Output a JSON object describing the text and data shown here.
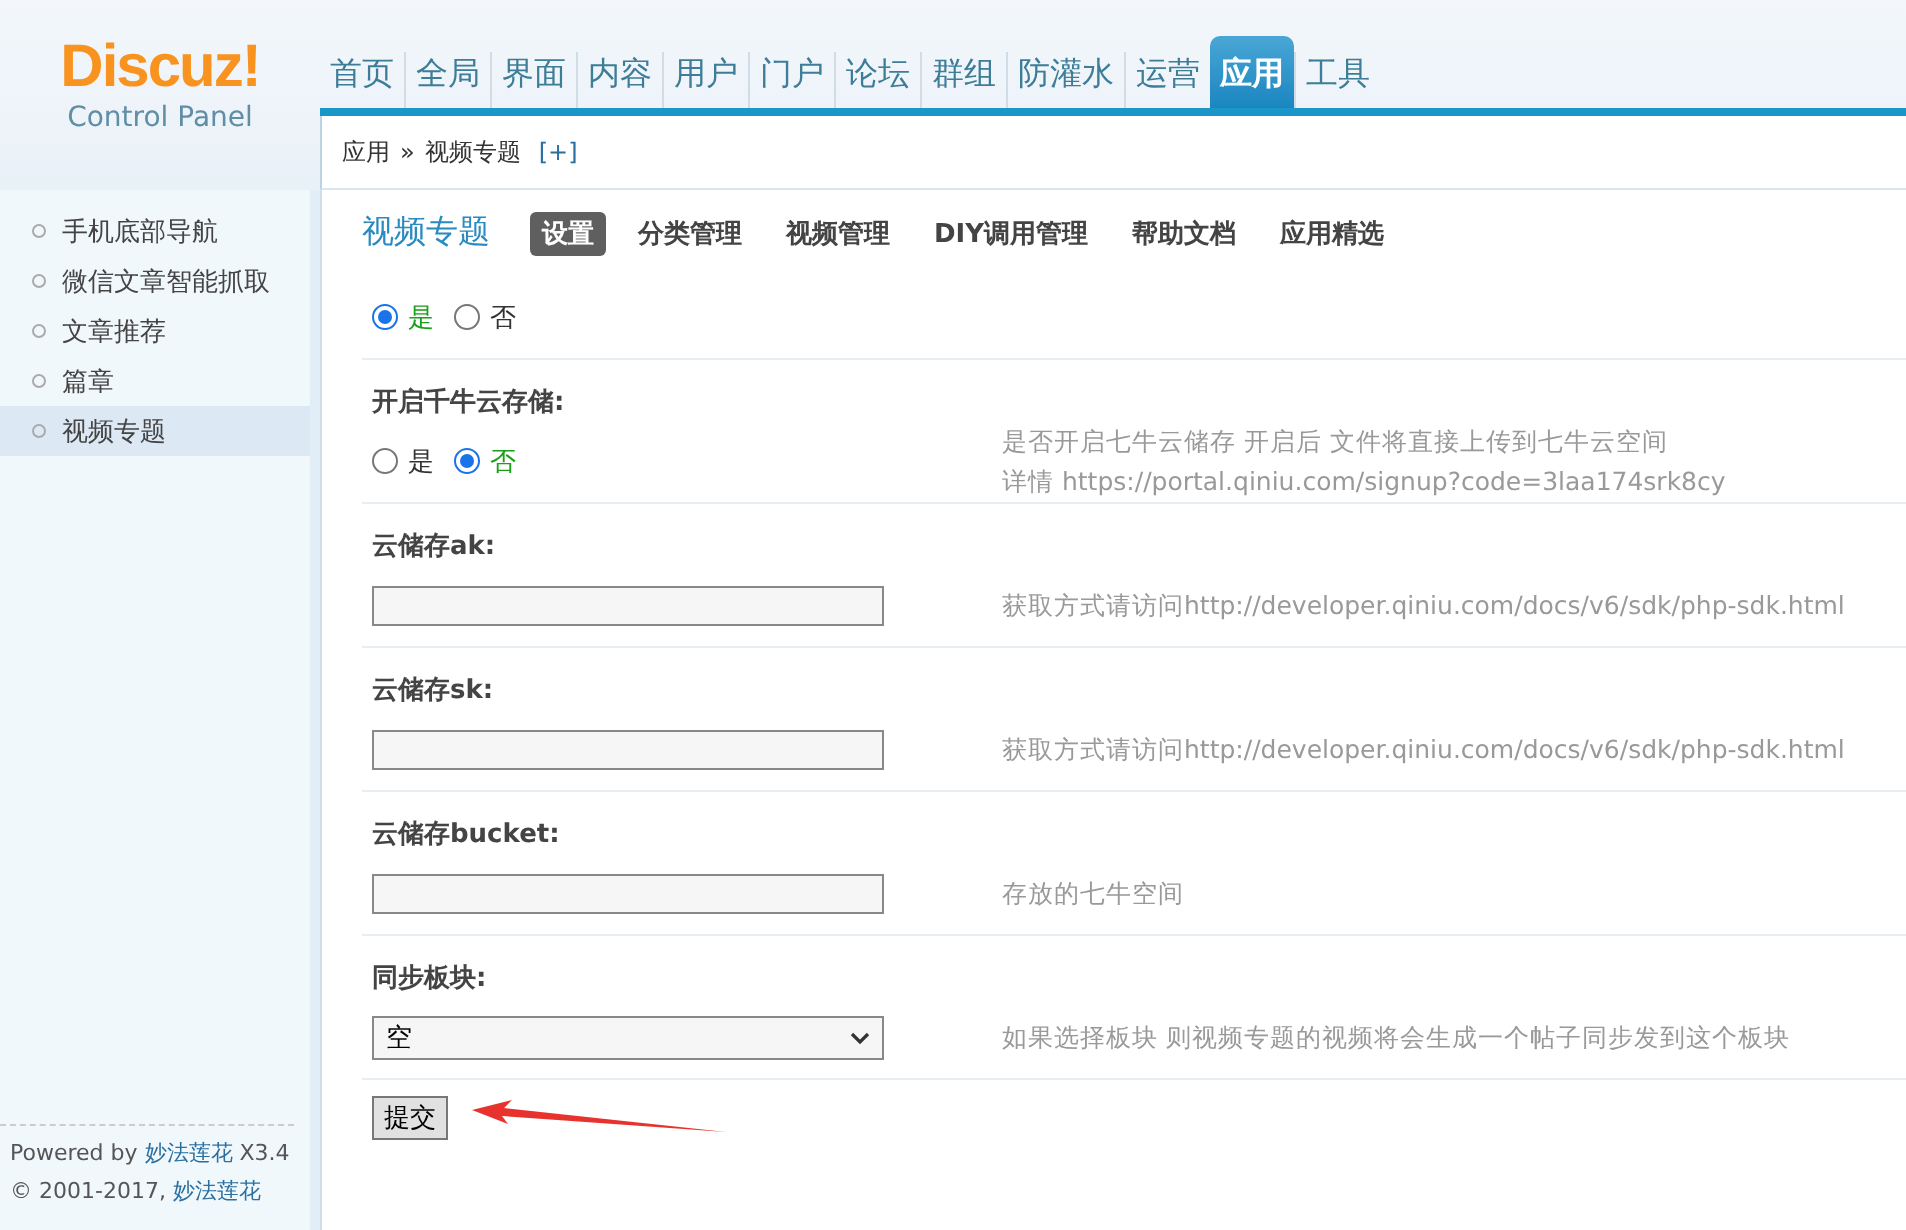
{
  "logo": {
    "brand": "Discuz!",
    "subtitle": "Control Panel"
  },
  "nav": [
    {
      "label": "首页",
      "selected": false
    },
    {
      "label": "全局",
      "selected": false
    },
    {
      "label": "界面",
      "selected": false
    },
    {
      "label": "内容",
      "selected": false
    },
    {
      "label": "用户",
      "selected": false
    },
    {
      "label": "门户",
      "selected": false
    },
    {
      "label": "论坛",
      "selected": false
    },
    {
      "label": "群组",
      "selected": false
    },
    {
      "label": "防灌水",
      "selected": false
    },
    {
      "label": "运营",
      "selected": false
    },
    {
      "label": "应用",
      "selected": true
    },
    {
      "label": "工具",
      "selected": false
    }
  ],
  "breadcrumb": {
    "parent": "应用",
    "separator": "»",
    "current": "视频专题",
    "add": "[+]"
  },
  "sidebar": {
    "items": [
      {
        "label": "手机底部导航",
        "selected": false
      },
      {
        "label": "微信文章智能抓取",
        "selected": false
      },
      {
        "label": "文章推荐",
        "selected": false
      },
      {
        "label": "篇章",
        "selected": false
      },
      {
        "label": "视频专题",
        "selected": true
      }
    ],
    "footer": {
      "powered": "Powered by",
      "powered_link": "妙法莲花",
      "version": "X3.4",
      "copyright": "© 2001-2017,",
      "copyright_link": "妙法莲花"
    }
  },
  "page": {
    "title": "视频专题",
    "tabs": [
      {
        "label": "设置",
        "selected": true
      },
      {
        "label": "分类管理",
        "selected": false
      },
      {
        "label": "视频管理",
        "selected": false
      },
      {
        "label": "DIY调用管理",
        "selected": false
      },
      {
        "label": "帮助文档",
        "selected": false
      },
      {
        "label": "应用精选",
        "selected": false
      }
    ]
  },
  "settings": [
    {
      "kind": "radio",
      "options": [
        {
          "label": "是",
          "selected": true
        },
        {
          "label": "否",
          "selected": false
        }
      ]
    },
    {
      "kind": "radio",
      "label": "开启千牛云存储:",
      "options": [
        {
          "label": "是",
          "selected": false
        },
        {
          "label": "否",
          "selected": true
        }
      ],
      "comment": [
        "是否开启七牛云储存 开启后 文件将直接上传到七牛云空间",
        "详情 https://portal.qiniu.com/signup?code=3laa174srk8cy"
      ]
    },
    {
      "kind": "text",
      "label": "云储存ak:",
      "comment": [
        "获取方式请访问http://developer.qiniu.com/docs/v6/sdk/php-sdk.html"
      ]
    },
    {
      "kind": "text",
      "label": "云储存sk:",
      "comment": [
        "获取方式请访问http://developer.qiniu.com/docs/v6/sdk/php-sdk.html"
      ]
    },
    {
      "kind": "text",
      "label": "云储存bucket:",
      "comment": [
        "存放的七牛空间"
      ]
    },
    {
      "kind": "select",
      "label": "同步板块:",
      "value": "空",
      "comment": [
        "如果选择板块 则视频专题的视频将会生成一个帖子同步发到这个板块"
      ]
    }
  ],
  "submit": "提交"
}
